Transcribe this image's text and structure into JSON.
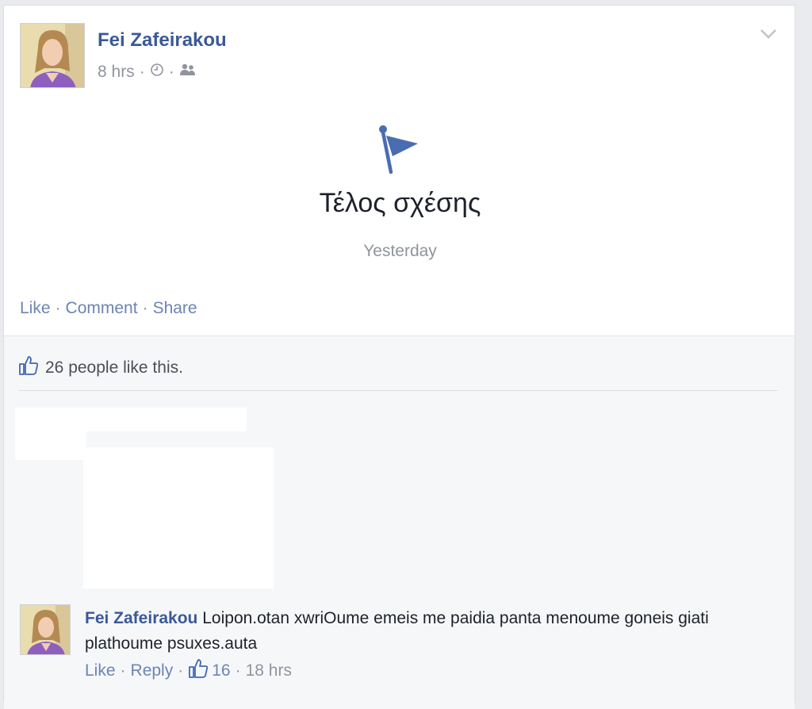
{
  "post": {
    "author": "Fei Zafeirakou",
    "time": "8 hrs",
    "meta_sep": "·",
    "event_title": "Τέλος σχέσης",
    "event_date": "Yesterday"
  },
  "actions": {
    "like": "Like",
    "comment": "Comment",
    "share": "Share",
    "sep": "·"
  },
  "likes": {
    "text": "26 people like this."
  },
  "comment": {
    "author": "Fei Zafeirakou",
    "text": "Loipon.otan xwriOume emeis me paidia panta menoume goneis giati plathoume psuxes.auta",
    "like": "Like",
    "reply": "Reply",
    "like_count": "16",
    "time": "18 hrs",
    "sep": "·"
  },
  "colors": {
    "link": "#3b5998",
    "muted": "#90949c",
    "action": "#6d84b4"
  },
  "icons": [
    "clock-icon",
    "friends-audience-icon",
    "chevron-down-icon",
    "flag-icon",
    "thumbs-up-icon"
  ]
}
